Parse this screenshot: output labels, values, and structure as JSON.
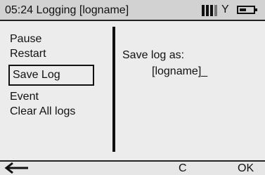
{
  "titlebar": {
    "title": "05:24 Logging [logname]",
    "icons": [
      "signal-bars-icon",
      "antenna-icon",
      "battery-icon"
    ]
  },
  "menu": {
    "items": [
      {
        "label": "Pause"
      },
      {
        "label": "Restart"
      },
      {
        "label": "Save Log",
        "selected": true
      },
      {
        "label": "Event"
      },
      {
        "label": "Clear All logs"
      }
    ]
  },
  "content": {
    "save_label": "Save log as:",
    "filename_value": "[logname]_"
  },
  "softkeys": {
    "back_icon": "back-arrow-icon",
    "c_label": "C",
    "ok_label": "OK"
  },
  "colors": {
    "title_bar": "#d2d2d2",
    "screen_bg": "#ececec",
    "text": "#111111"
  }
}
